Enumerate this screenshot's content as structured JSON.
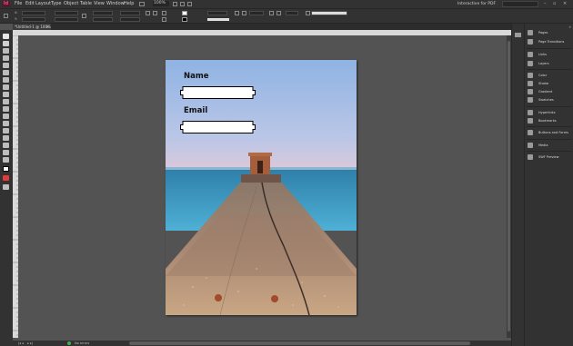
{
  "app": {
    "logo": "Id",
    "zoom": "100%",
    "workspace": "Interactive for PDF"
  },
  "menu": [
    "File",
    "Edit",
    "Layout",
    "Type",
    "Object",
    "Table",
    "View",
    "Window",
    "Help"
  ],
  "document": {
    "tab_title": "*Untitled-1 @ 100%"
  },
  "form": {
    "name_label": "Name",
    "email_label": "Email"
  },
  "panels": [
    "Pages",
    "Page Transitions",
    "Links",
    "Layers",
    "Color",
    "Stroke",
    "Gradient",
    "Swatches",
    "Hyperlinks",
    "Bookmarks",
    "Buttons and Forms",
    "Media",
    "SWF Preview"
  ],
  "status": {
    "preflight": "No errors"
  },
  "colors": {
    "accent": "#ff3d7f",
    "ui_dark": "#323232",
    "pasteboard": "#535353"
  }
}
